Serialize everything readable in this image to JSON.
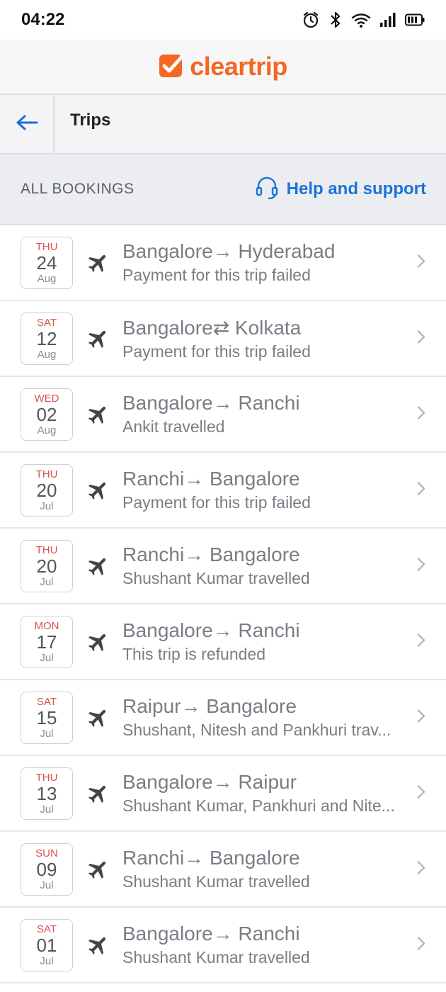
{
  "statusbar": {
    "time": "04:22"
  },
  "brand": {
    "name": "cleartrip",
    "color": "#f26722"
  },
  "nav": {
    "title": "Trips"
  },
  "section": {
    "title": "ALL BOOKINGS",
    "help_label": "Help and support"
  },
  "trips": [
    {
      "dow": "THU",
      "day": "24",
      "month": "Aug",
      "route": "Bangalore→ Hyderabad",
      "status": "Payment for this trip failed"
    },
    {
      "dow": "SAT",
      "day": "12",
      "month": "Aug",
      "route": "Bangalore⇄ Kolkata",
      "status": "Payment for this trip failed"
    },
    {
      "dow": "WED",
      "day": "02",
      "month": "Aug",
      "route": "Bangalore→ Ranchi",
      "status": "Ankit travelled"
    },
    {
      "dow": "THU",
      "day": "20",
      "month": "Jul",
      "route": "Ranchi→ Bangalore",
      "status": "Payment for this trip failed"
    },
    {
      "dow": "THU",
      "day": "20",
      "month": "Jul",
      "route": "Ranchi→ Bangalore",
      "status": "Shushant Kumar travelled"
    },
    {
      "dow": "MON",
      "day": "17",
      "month": "Jul",
      "route": "Bangalore→ Ranchi",
      "status": "This trip is refunded"
    },
    {
      "dow": "SAT",
      "day": "15",
      "month": "Jul",
      "route": "Raipur→ Bangalore",
      "status": "Shushant, Nitesh and Pankhuri trav..."
    },
    {
      "dow": "THU",
      "day": "13",
      "month": "Jul",
      "route": "Bangalore→ Raipur",
      "status": "Shushant Kumar, Pankhuri and Nite..."
    },
    {
      "dow": "SUN",
      "day": "09",
      "month": "Jul",
      "route": "Ranchi→ Bangalore",
      "status": "Shushant Kumar travelled"
    },
    {
      "dow": "SAT",
      "day": "01",
      "month": "Jul",
      "route": "Bangalore→ Ranchi",
      "status": "Shushant Kumar travelled"
    }
  ]
}
